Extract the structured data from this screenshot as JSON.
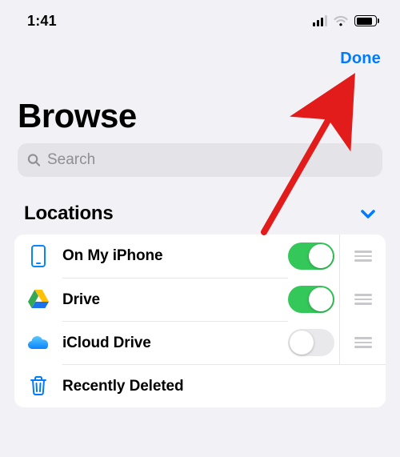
{
  "statusbar": {
    "time": "1:41"
  },
  "nav": {
    "done": "Done"
  },
  "title": "Browse",
  "search": {
    "placeholder": "Search"
  },
  "section": {
    "locations_header": "Locations"
  },
  "rows": {
    "on_my_iphone": "On My iPhone",
    "drive": "Drive",
    "icloud_drive": "iCloud Drive",
    "recently_deleted": "Recently Deleted"
  },
  "toggles": {
    "on_my_iphone": true,
    "drive": true,
    "icloud_drive": false
  }
}
